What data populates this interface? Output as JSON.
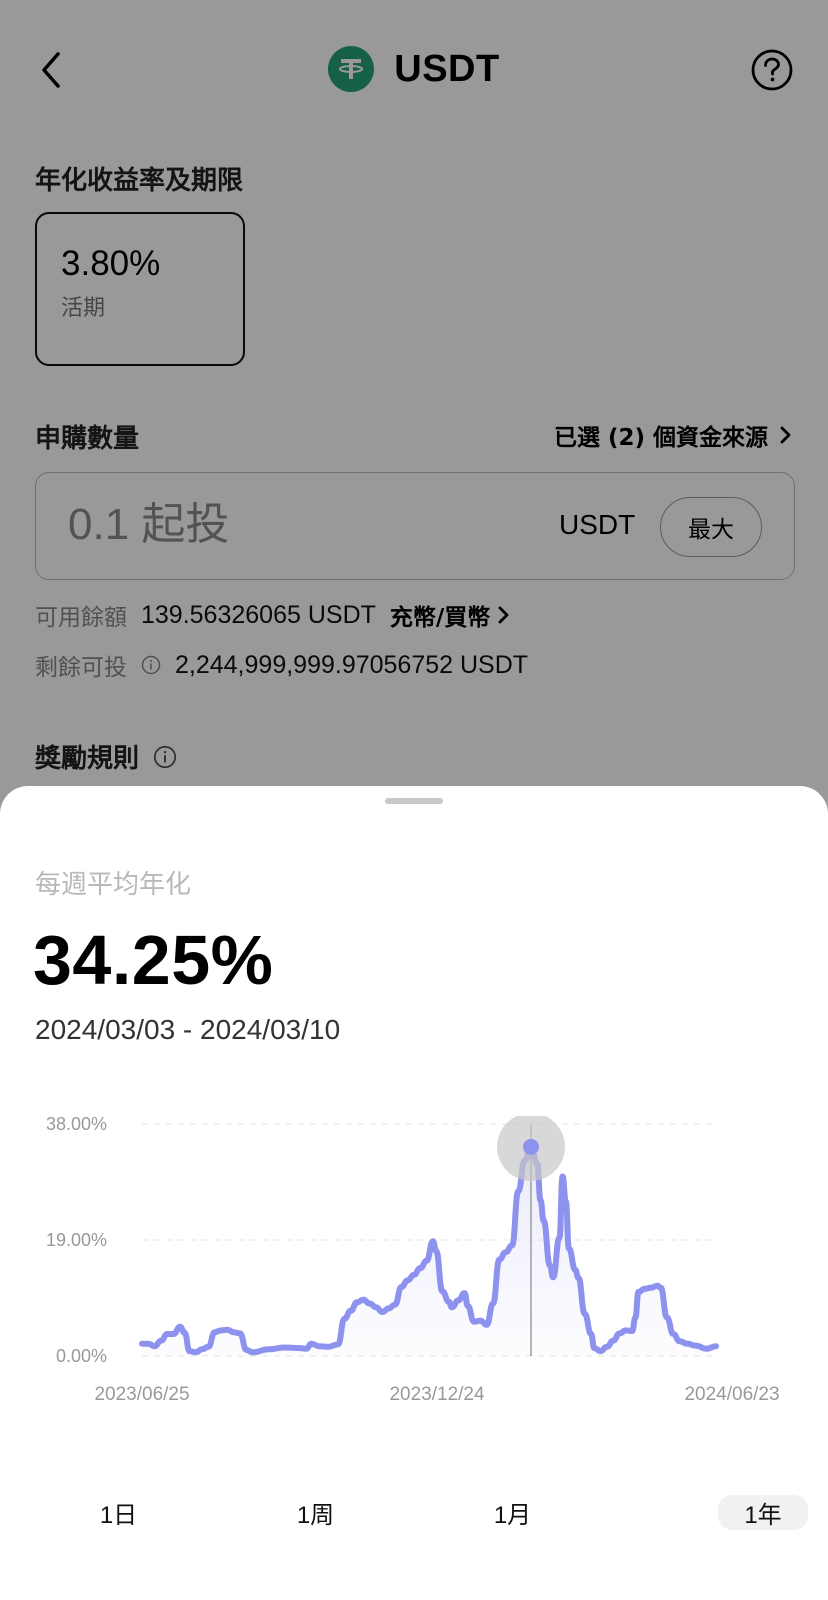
{
  "header": {
    "title": "USDT",
    "back_icon": "chevron-left-icon",
    "help_icon": "question-circle-icon",
    "coin_color": "#26A17B"
  },
  "apy_section": {
    "label": "年化收益率及期限",
    "rate": "3.80%",
    "term": "活期"
  },
  "subscribe": {
    "label": "申購數量",
    "funds_source": "已選 (2) 個資金來源",
    "amount_placeholder": "0.1 起投",
    "unit": "USDT",
    "max_label": "最大"
  },
  "balance": {
    "available_label": "可用餘額",
    "available_value": "139.56326065 USDT",
    "deposit_link": "充幣/買幣",
    "remaining_label": "剩餘可投",
    "remaining_value": "2,244,999,999.97056752 USDT"
  },
  "rewards": {
    "label": "獎勵規則"
  },
  "sheet": {
    "label": "每週平均年化",
    "value": "34.25%",
    "range": "2024/03/03 - 2024/03/10"
  },
  "chart_data": {
    "type": "line",
    "x_start": "2023/06/25",
    "x_end": "2024/06/23",
    "x_ticks": [
      "2023/06/25",
      "2023/12/24",
      "2024/06/23"
    ],
    "y_ticks": [
      "38.00%",
      "19.00%",
      "0.00%"
    ],
    "ylim": [
      0,
      38
    ],
    "line_color": "#8d92ee",
    "highlight": {
      "x": "2024/03/03",
      "y": 34.25
    },
    "series": [
      {
        "points": [
          [
            0,
            2.0
          ],
          [
            4,
            2.0
          ],
          [
            8,
            1.6
          ],
          [
            12,
            2.5
          ],
          [
            16,
            3.6
          ],
          [
            20,
            3.6
          ],
          [
            24,
            4.8
          ],
          [
            27,
            3.8
          ],
          [
            30,
            0.8
          ],
          [
            34,
            0.6
          ],
          [
            38,
            1.1
          ],
          [
            42,
            1.5
          ],
          [
            46,
            3.9
          ],
          [
            50,
            4.2
          ],
          [
            54,
            4.3
          ],
          [
            58,
            3.9
          ],
          [
            62,
            3.7
          ],
          [
            66,
            1.0
          ],
          [
            70,
            0.6
          ],
          [
            80,
            1.1
          ],
          [
            90,
            1.4
          ],
          [
            100,
            1.3
          ],
          [
            104,
            1.2
          ],
          [
            107,
            2.0
          ],
          [
            112,
            1.6
          ],
          [
            118,
            1.5
          ],
          [
            124,
            1.9
          ],
          [
            128,
            6.1
          ],
          [
            132,
            7.4
          ],
          [
            136,
            8.8
          ],
          [
            140,
            9.2
          ],
          [
            144,
            8.6
          ],
          [
            148,
            8.0
          ],
          [
            152,
            7.2
          ],
          [
            156,
            7.8
          ],
          [
            160,
            8.4
          ],
          [
            164,
            11.3
          ],
          [
            168,
            12.4
          ],
          [
            172,
            13.3
          ],
          [
            176,
            14.4
          ],
          [
            180,
            15.6
          ],
          [
            184,
            18.8
          ],
          [
            186,
            17.2
          ],
          [
            190,
            10.6
          ],
          [
            194,
            8.9
          ],
          [
            196,
            8.0
          ],
          [
            200,
            9.1
          ],
          [
            204,
            10.3
          ],
          [
            206,
            8.2
          ],
          [
            210,
            5.6
          ],
          [
            214,
            5.8
          ],
          [
            218,
            5.1
          ],
          [
            222,
            8.6
          ],
          [
            226,
            15.8
          ],
          [
            230,
            17.0
          ],
          [
            234,
            18.1
          ],
          [
            238,
            27.0
          ],
          [
            242,
            32.0
          ],
          [
            246,
            34.25
          ],
          [
            250,
            31.5
          ],
          [
            252,
            25.5
          ],
          [
            254,
            22.2
          ],
          [
            258,
            14.8
          ],
          [
            260,
            12.9
          ],
          [
            264,
            19.4
          ],
          [
            266,
            29.4
          ],
          [
            268,
            25.3
          ],
          [
            270,
            17.6
          ],
          [
            274,
            14.1
          ],
          [
            276,
            12.8
          ],
          [
            280,
            6.9
          ],
          [
            284,
            3.6
          ],
          [
            286,
            1.3
          ],
          [
            290,
            0.8
          ],
          [
            294,
            1.5
          ],
          [
            298,
            2.5
          ],
          [
            302,
            3.7
          ],
          [
            306,
            4.2
          ],
          [
            310,
            4.1
          ],
          [
            312,
            6.3
          ],
          [
            314,
            10.5
          ],
          [
            318,
            11.0
          ],
          [
            322,
            11.2
          ],
          [
            326,
            11.5
          ],
          [
            328,
            11.2
          ],
          [
            332,
            6.3
          ],
          [
            336,
            3.6
          ],
          [
            340,
            2.4
          ],
          [
            345,
            2.0
          ],
          [
            350,
            1.7
          ],
          [
            357,
            1.2
          ],
          [
            363,
            1.6
          ]
        ]
      }
    ]
  },
  "period_tabs": [
    "1日",
    "1周",
    "1月",
    "1年"
  ],
  "active_period": "1年"
}
